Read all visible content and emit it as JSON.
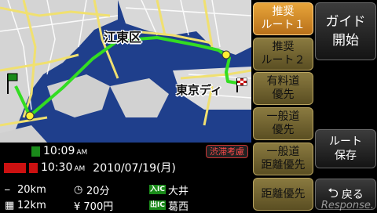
{
  "map": {
    "labels": [
      "江東区",
      "東京ディ"
    ],
    "route_color": "#33dd22",
    "road_color": "#f0e070"
  },
  "trip": {
    "badge": "渋滞考慮",
    "depart_time": "10:09",
    "depart_suffix": "AM",
    "arrive_time": "10:30",
    "arrive_suffix": "AM",
    "arrive_date": "2010/07/19(月)",
    "distance_total": "20km",
    "distance_toll": "12km",
    "duration": "20分",
    "toll_fee": "¥ 700円",
    "entry_ic_tag": "入IC",
    "entry_ic": "大井",
    "exit_ic_tag": "出IC",
    "exit_ic": "葛西"
  },
  "route_options": [
    {
      "lines": [
        "推奨",
        "ルート１"
      ],
      "selected": true
    },
    {
      "lines": [
        "推奨",
        "ルート２"
      ],
      "selected": false
    },
    {
      "lines": [
        "有料道",
        "優先"
      ],
      "selected": false
    },
    {
      "lines": [
        "一般道",
        "優先"
      ],
      "selected": false
    },
    {
      "lines": [
        "一般道",
        "距離優先"
      ],
      "selected": false
    },
    {
      "lines": [
        "距離優先"
      ],
      "selected": false
    }
  ],
  "side_buttons": {
    "guide": [
      "ガイド",
      "開始"
    ],
    "save": [
      "ルート",
      "保存"
    ],
    "back": "戻る"
  },
  "watermark": "Response."
}
